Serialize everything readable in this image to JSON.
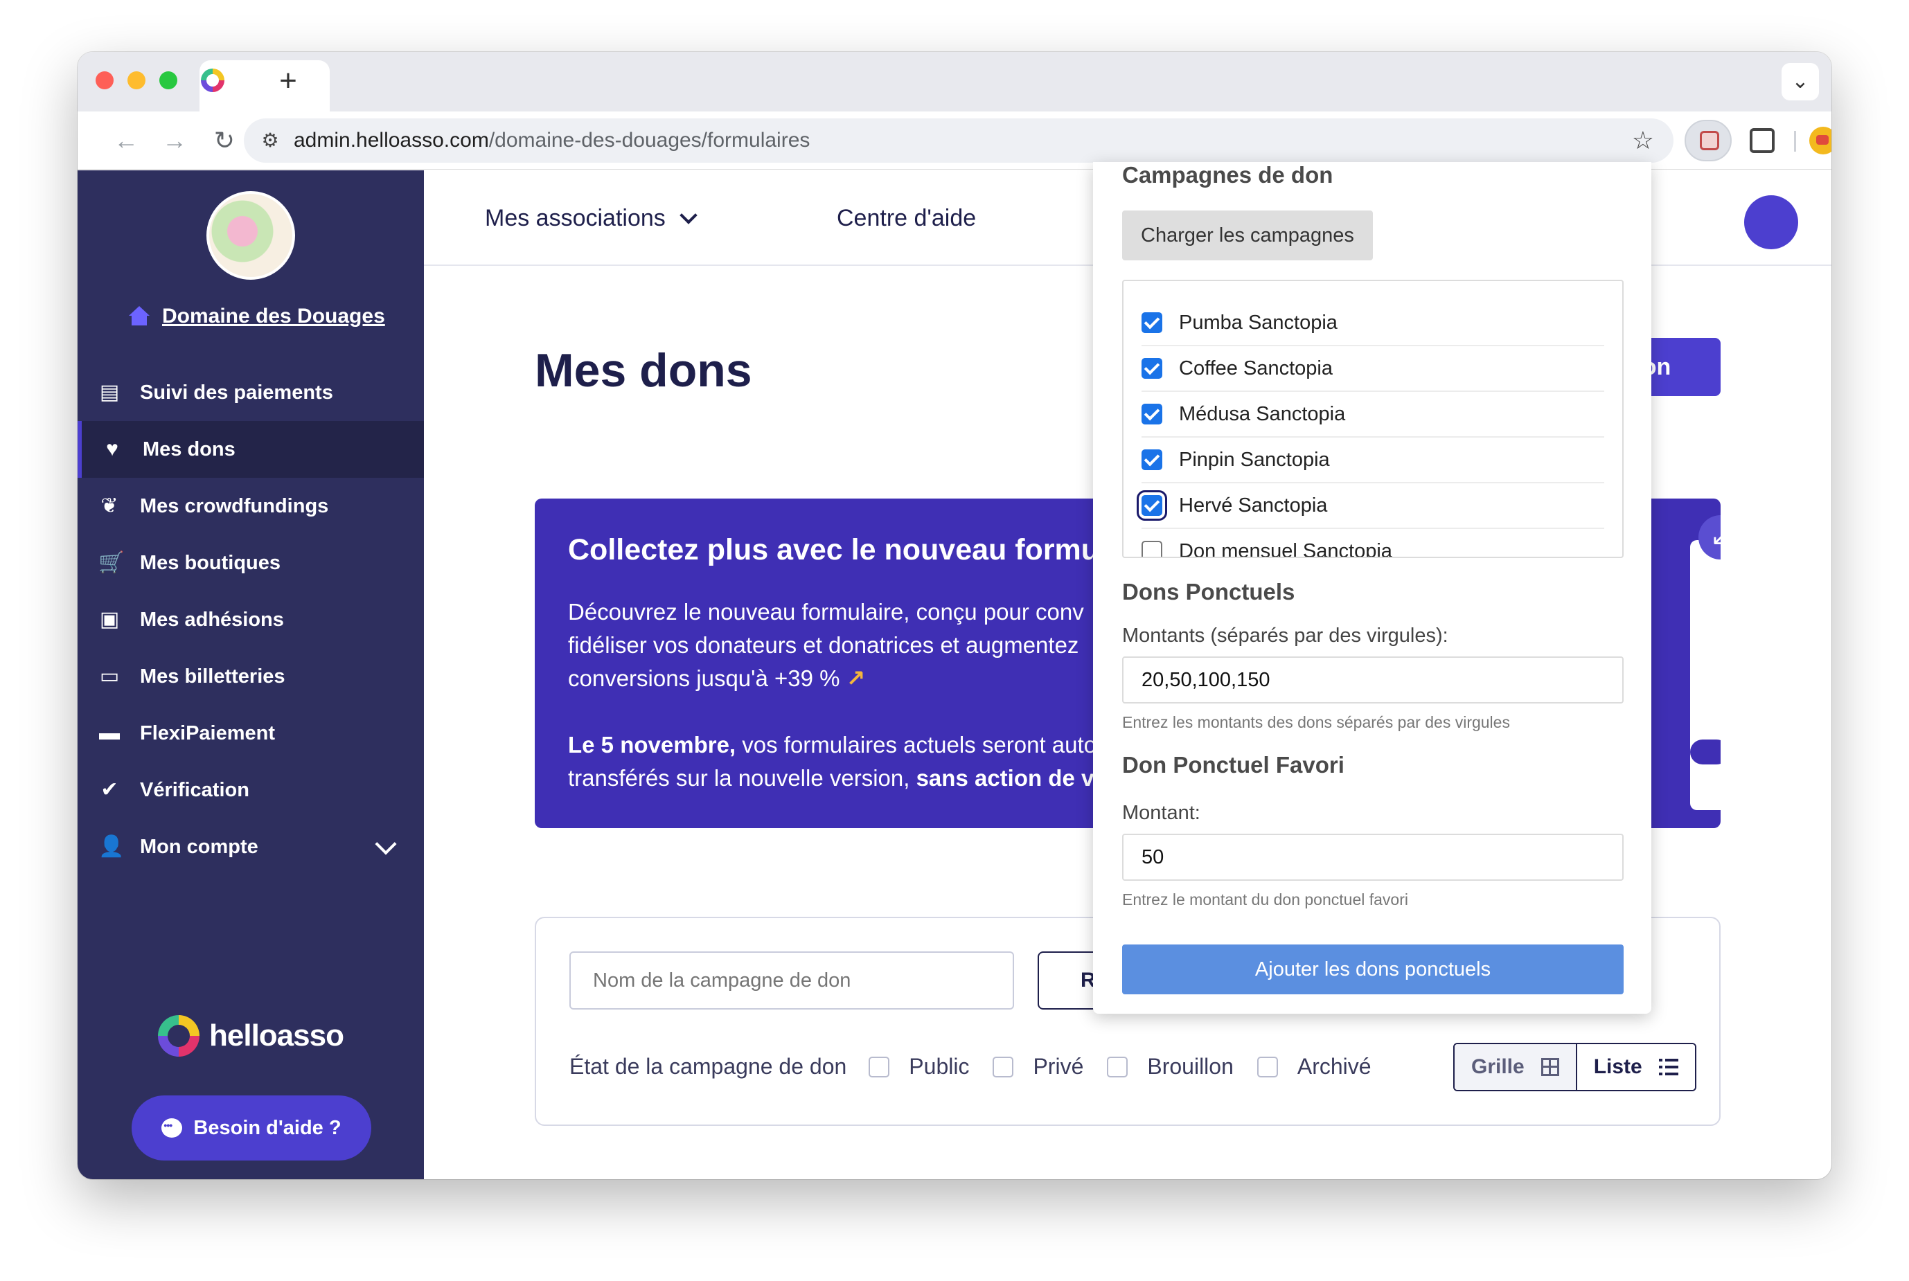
{
  "browser": {
    "new_tab_glyph": "+",
    "url_host": "admin.helloasso.com",
    "url_path": "/domaine-des-douages/formulaires",
    "back_glyph": "←",
    "forward_glyph": "→",
    "reload_glyph": "↻",
    "site_info_glyph": "⚙",
    "star_glyph": "☆",
    "tabs_menu_glyph": "⌄",
    "kebab_glyph": "⋮"
  },
  "sidebar": {
    "org_name": "Domaine des Douages",
    "items": [
      {
        "label": "Suivi des paiements",
        "icon": "chart-icon",
        "glyph": "▤"
      },
      {
        "label": "Mes dons",
        "icon": "heart-icon",
        "glyph": "♥",
        "active": true
      },
      {
        "label": "Mes crowdfundings",
        "icon": "sprout-icon",
        "glyph": "❦"
      },
      {
        "label": "Mes boutiques",
        "icon": "cart-icon",
        "glyph": "🛒"
      },
      {
        "label": "Mes adhésions",
        "icon": "id-card-icon",
        "glyph": "▣"
      },
      {
        "label": "Mes billetteries",
        "icon": "ticket-icon",
        "glyph": "▭"
      },
      {
        "label": "FlexiPaiement",
        "icon": "credit-card-icon",
        "glyph": "▬"
      },
      {
        "label": "Vérification",
        "icon": "verified-icon",
        "glyph": "✔"
      },
      {
        "label": "Mon compte",
        "icon": "user-icon",
        "glyph": "👤"
      }
    ],
    "brand": "helloasso",
    "help_button": "Besoin d'aide ?"
  },
  "topnav": {
    "associations": "Mes associations",
    "help_center": "Centre d'aide"
  },
  "main": {
    "title": "Mes dons",
    "create_button": "don",
    "banner": {
      "title": "Collectez plus avec le nouveau formulai",
      "line1": "Découvrez le nouveau formulaire, conçu pour conv",
      "line2": "fidéliser vos donateurs et donatrices et augmentez",
      "line3": "conversions jusqu'à +39 %",
      "arrow": "↗",
      "p2_bold": "Le 5 novembre,",
      "p2_rest": " vos formulaires actuels seront auto",
      "p2_line2": "transférés sur la nouvelle version, ",
      "p2_bold2": "sans action de v",
      "corner_glyph": "↙"
    },
    "filters": {
      "search_placeholder": "Nom de la campagne de don",
      "reset_button": "R",
      "state_label": "État de la campagne de don",
      "states": [
        "Public",
        "Privé",
        "Brouillon",
        "Archivé"
      ],
      "view_grid": "Grille",
      "view_list": "Liste"
    }
  },
  "popup": {
    "campaigns_heading": "Campagnes de don",
    "load_button": "Charger les campagnes",
    "campaigns": [
      {
        "name": "Pumba Sanctopia",
        "checked": true
      },
      {
        "name": "Coffee Sanctopia",
        "checked": true
      },
      {
        "name": "Médusa Sanctopia",
        "checked": true
      },
      {
        "name": "Pinpin Sanctopia",
        "checked": true
      },
      {
        "name": "Hervé Sanctopia",
        "checked": true
      },
      {
        "name": "Don mensuel Sanctopia",
        "checked": false
      }
    ],
    "ponctuels_heading": "Dons Ponctuels",
    "amounts_label": "Montants (séparés par des virgules):",
    "amounts_value": "20,50,100,150",
    "amounts_hint": "Entrez les montants des dons séparés par des virgules",
    "favorite_heading": "Don Ponctuel Favori",
    "amount_label": "Montant:",
    "amount_value": "50",
    "amount_hint": "Entrez le montant du don ponctuel favori",
    "submit_button": "Ajouter les dons ponctuels"
  }
}
